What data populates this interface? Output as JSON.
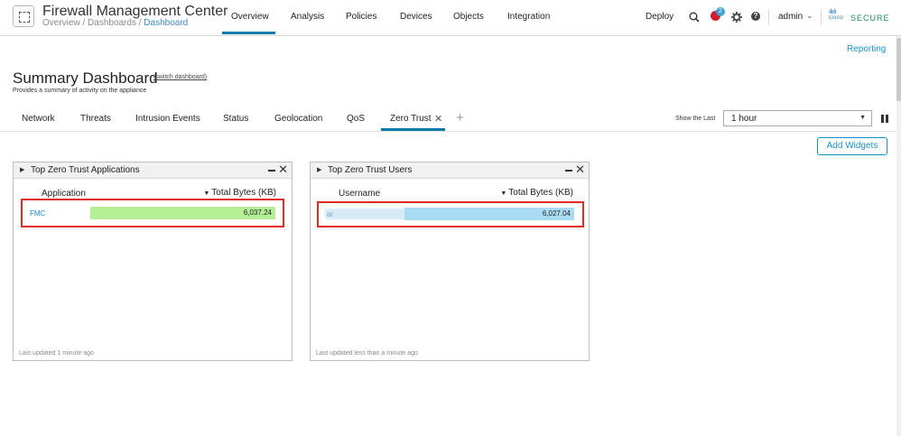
{
  "header": {
    "app_title": "Firewall Management Center",
    "breadcrumb": {
      "part1": "Overview",
      "sep1": " / ",
      "part2": "Dashboards",
      "sep2": " / ",
      "current": "Dashboard"
    },
    "nav": [
      "Overview",
      "Analysis",
      "Policies",
      "Devices",
      "Objects",
      "Integration"
    ],
    "active_nav": "Overview",
    "deploy_label": "Deploy",
    "notification_count": "2",
    "help_glyph": "?",
    "user_label": "admin",
    "brand_small": "cisco",
    "brand_secure": "SECURE"
  },
  "page": {
    "reporting_link": "Reporting",
    "title": "Summary Dashboard",
    "switch_link": "(switch dashboard)",
    "subtitle": "Provides a summary of activity on the appliance"
  },
  "tabs": {
    "items": [
      "Network",
      "Threats",
      "Intrusion Events",
      "Status",
      "Geolocation",
      "QoS",
      "Zero Trust"
    ],
    "active": "Zero Trust",
    "show_last_label": "Show the Last",
    "time_range": "1 hour",
    "add_widgets_label": "Add Widgets"
  },
  "widgets": [
    {
      "title": "Top Zero Trust Applications",
      "col_left": "Application",
      "col_right": "Total Bytes (KB)",
      "row": {
        "name": "FMC",
        "value": "6,037.24",
        "fill_fraction": 1.0
      },
      "footer": "Last updated 1 minute ago"
    },
    {
      "title": "Top Zero Trust Users",
      "col_left": "Username",
      "col_right": "Total Bytes (KB)",
      "row": {
        "name": "ar",
        "value": "6,027.04",
        "fill_fraction": 1.0
      },
      "footer": "Last updated less than a minute ago"
    }
  ],
  "colors": {
    "accent": "#0a7aa8",
    "link": "#1a8fc6",
    "highlight_box": "#e02a24",
    "app_bar": "#b4ef96",
    "user_bar": "#a9dcf3"
  },
  "icons": [
    "logo-icon",
    "search-icon",
    "bug-icon",
    "gear-icon",
    "help-icon",
    "chevron-down-icon",
    "close-icon",
    "plus-icon",
    "pause-icon",
    "caret-right-icon",
    "minimize-icon",
    "sort-desc-icon"
  ]
}
